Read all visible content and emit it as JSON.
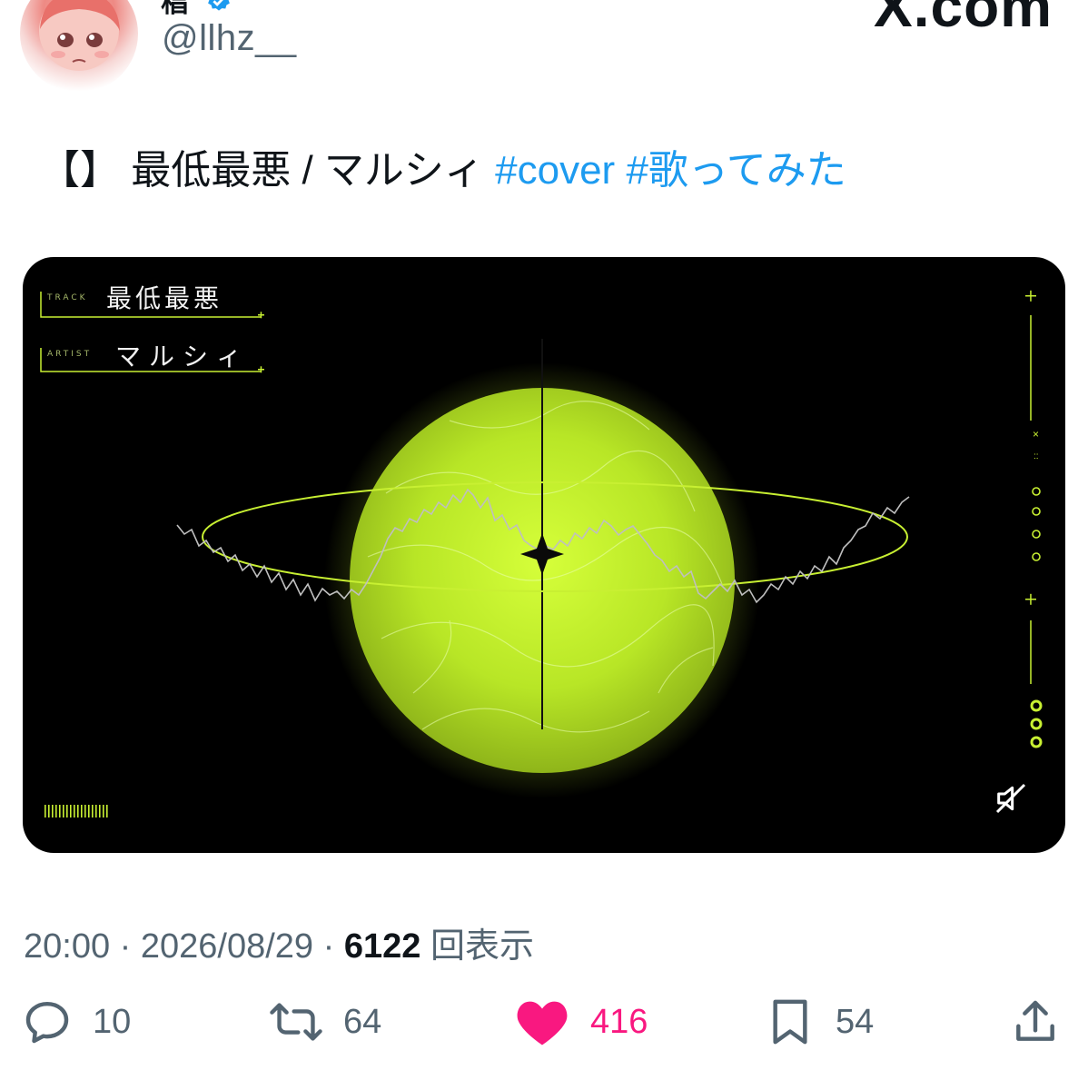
{
  "header": {
    "display_name_fragment": "椙",
    "handle": "@llhz__",
    "site_logo_text": "X.com"
  },
  "tweet": {
    "text_prefix": "【】 最低最悪 / マルシィ ",
    "hashtags": [
      "#cover",
      "#歌ってみた"
    ]
  },
  "media": {
    "track_label": "TRACK",
    "track_title": "最低最悪",
    "artist_label": "ARTIST",
    "artist_name": "マルシィ",
    "side_glyphs": [
      "×",
      "::"
    ],
    "accent_color": "#c8f032",
    "sound_state": "muted"
  },
  "meta": {
    "time": "20:00",
    "separator": " · ",
    "date": "2026/08/29",
    "views": "6122",
    "views_label": "回表示"
  },
  "actions": {
    "replies": "10",
    "reposts": "64",
    "likes": "416",
    "bookmarks": "54"
  },
  "colors": {
    "link": "#1d9bf0",
    "like": "#f91880",
    "secondary_text": "#536471"
  }
}
